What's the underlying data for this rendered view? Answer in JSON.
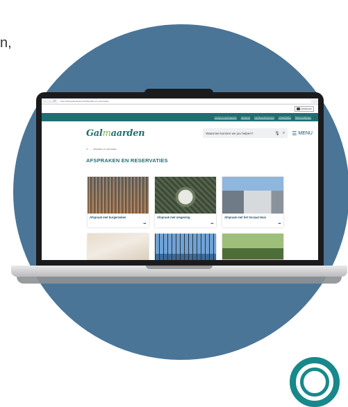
{
  "cut_text": "n,",
  "browser": {
    "url": "https://www.galmaarden.be/afspraken-en-reservaties",
    "nav_glyphs": [
      "←",
      "→",
      "⟳"
    ]
  },
  "top": {
    "login_label": "AANMELDEN"
  },
  "nav_links": [
    "Contact & openingsuren",
    "Vacatures",
    "Familieondersteuning",
    "Afvalophaling",
    "Bekendmakingen"
  ],
  "header": {
    "logo_part1": "Gal",
    "logo_part2": "m",
    "logo_part3": "aarden",
    "search_placeholder": "Waarmee kunnen we jou helpen?",
    "menu_label": "MENU",
    "icons": [
      "microphone-icon",
      "search-icon",
      "hamburger-icon"
    ]
  },
  "breadcrumb": {
    "current": "Afspraken en reservaties"
  },
  "page_title": "AFSPRAKEN EN RESERVATIES",
  "cards": [
    {
      "title": "Afspraak met burgerzaken",
      "more": "•••"
    },
    {
      "title": "Afspraak met omgeving",
      "more": "•••"
    },
    {
      "title": "Afspraak met het Sociaal Huis",
      "more": "•••"
    },
    {
      "title": "",
      "more": ""
    },
    {
      "title": "",
      "more": ""
    },
    {
      "title": "",
      "more": ""
    }
  ],
  "colors": {
    "circle": "#4a7597",
    "brand_teal": "#1f6f72",
    "nav_teal": "#1f6f72",
    "accent_green": "#7fb34a",
    "ring_teal": "#18888b"
  }
}
